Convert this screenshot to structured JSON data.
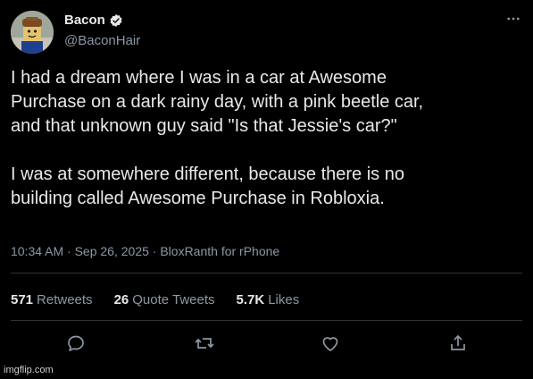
{
  "author": {
    "name": "Bacon",
    "handle": "@BaconHair",
    "avatar_icon": "roblox-bacon-hair-avatar",
    "verified_icon": "verified-badge-icon"
  },
  "tweet": {
    "text": "I had a dream where I was in a car at Awesome\nPurchase on a dark rainy day, with a pink beetle car,\nand that unknown guy said \"Is that Jessie's car?\"\n\nI was at somewhere different, because there is no\nbuilding called Awesome Purchase in Robloxia.",
    "meta": "10:34 AM · Sep 26, 2025 · BloxRanth for rPhone"
  },
  "stats": [
    {
      "count": "571",
      "label": "Retweets"
    },
    {
      "count": "26",
      "label": "Quote Tweets"
    },
    {
      "count": "5.7K",
      "label": "Likes"
    }
  ],
  "actions": [
    {
      "name": "reply-icon"
    },
    {
      "name": "retweet-icon"
    },
    {
      "name": "like-icon"
    },
    {
      "name": "share-icon"
    }
  ],
  "watermark": "imgflip.com",
  "colors": {
    "background": "#000000",
    "text": "#e7e9ea",
    "muted": "#8b98a5",
    "divider": "#2f3336"
  }
}
